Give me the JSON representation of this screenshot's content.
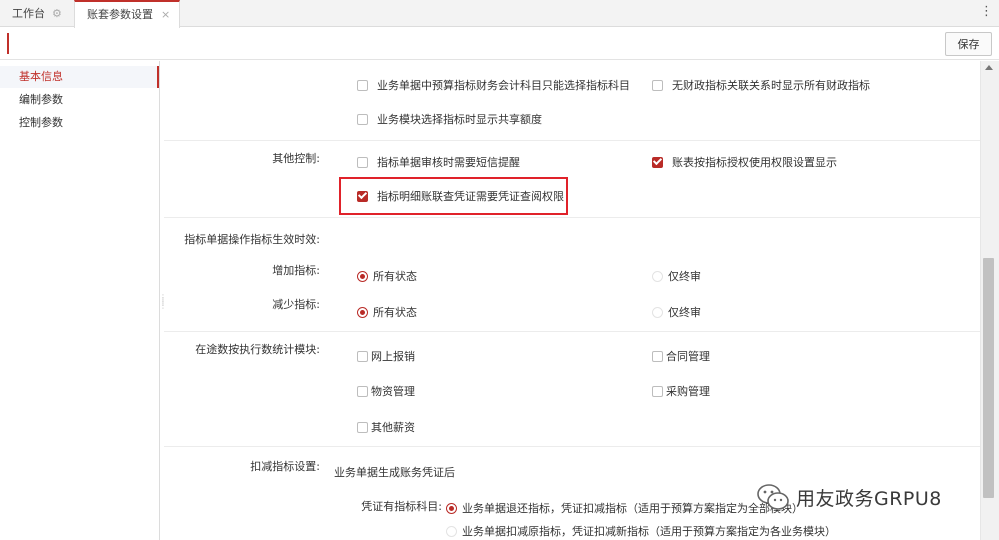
{
  "tabs": [
    {
      "label": "工作台",
      "icon": "gear-icon"
    },
    {
      "label": "账套参数设置",
      "icon": "close-icon"
    }
  ],
  "toolbar": {
    "save_label": "保存"
  },
  "nav": {
    "items": [
      {
        "label": "基本信息",
        "active": true
      },
      {
        "label": "编制参数",
        "active": false
      },
      {
        "label": "控制参数",
        "active": false
      }
    ]
  },
  "form": {
    "top_options": {
      "opt1": {
        "label": "业务单据中预算指标财务会计科目只能选择指标科目",
        "checked": false
      },
      "opt2": {
        "label": "无财政指标关联关系时显示所有财政指标",
        "checked": false
      },
      "opt3": {
        "label": "业务模块选择指标时显示共享额度",
        "checked": false
      }
    },
    "other_control": {
      "label": "其他控制:",
      "opt1": {
        "label": "指标单据审核时需要短信提醒",
        "checked": false
      },
      "opt2": {
        "label": "账表按指标授权使用权限设置显示",
        "checked": true
      },
      "opt3": {
        "label": "指标明细账联查凭证需要凭证查阅权限",
        "checked": true
      }
    },
    "effective_time": {
      "label": "指标单据操作指标生效时效:"
    },
    "increase": {
      "label": "增加指标:",
      "opt1": {
        "label": "所有状态",
        "selected": true
      },
      "opt2": {
        "label": "仅终审",
        "selected": false
      }
    },
    "decrease": {
      "label": "减少指标:",
      "opt1": {
        "label": "所有状态",
        "selected": true
      },
      "opt2": {
        "label": "仅终审",
        "selected": false
      }
    },
    "modules": {
      "label": "在途数按执行数统计模块:",
      "items": [
        {
          "label": "网上报销",
          "checked": false
        },
        {
          "label": "合同管理",
          "checked": false
        },
        {
          "label": "物资管理",
          "checked": false
        },
        {
          "label": "采购管理",
          "checked": false
        },
        {
          "label": "其他薪资",
          "checked": false
        }
      ]
    },
    "deduct": {
      "label": "扣减指标设置:",
      "note": "业务单据生成账务凭证后",
      "voucher_label": "凭证有指标科目:",
      "opt1": {
        "label": "业务单据退还指标，凭证扣减指标（适用于预算方案指定为全部模块）",
        "selected": true
      },
      "opt2": {
        "label": "业务单据扣减原指标，凭证扣减新指标（适用于预算方案指定为各业务模块）",
        "selected": false
      }
    }
  },
  "watermark": {
    "text": "用友政务GRPU8",
    "icon": "wechat-logo-icon"
  },
  "colors": {
    "accent": "#c0302a",
    "highlight_border": "#e0222a"
  }
}
